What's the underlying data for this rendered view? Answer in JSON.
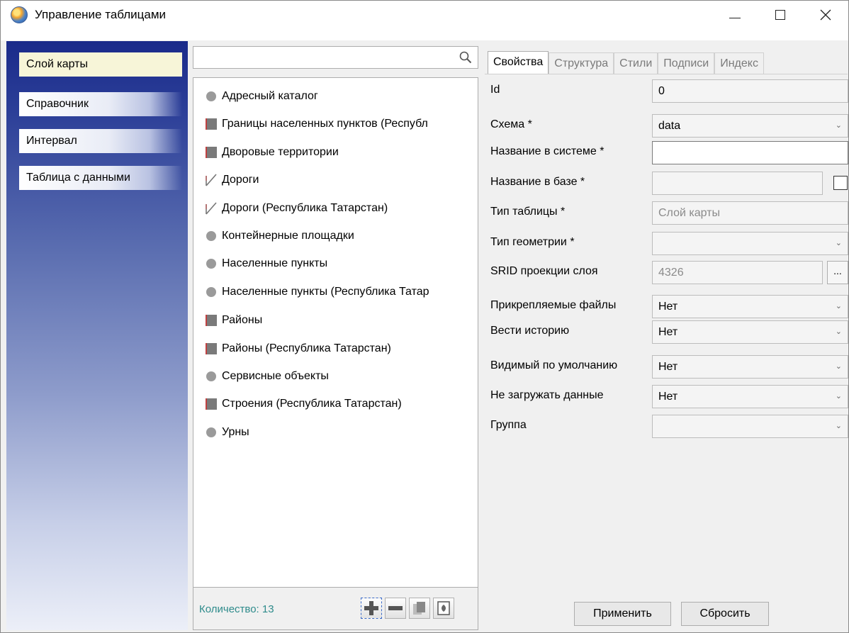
{
  "window": {
    "title": "Управление таблицами"
  },
  "nav": {
    "items": [
      {
        "label": "Слой карты",
        "active": true
      },
      {
        "label": "Справочник",
        "active": false
      },
      {
        "label": "Интервал",
        "active": false
      },
      {
        "label": "Таблица с данными",
        "active": false
      }
    ]
  },
  "search": {
    "value": "",
    "placeholder": ""
  },
  "list": {
    "items": [
      {
        "label": "Адресный каталог",
        "icon": "point-icon"
      },
      {
        "label": "Границы населенных пунктов (Республ",
        "icon": "polygon-icon"
      },
      {
        "label": "Дворовые территории",
        "icon": "polygon-icon"
      },
      {
        "label": "Дороги",
        "icon": "line-icon"
      },
      {
        "label": "Дороги (Республика Татарстан)",
        "icon": "line-icon"
      },
      {
        "label": "Контейнерные площадки",
        "icon": "point-icon"
      },
      {
        "label": "Населенные пункты",
        "icon": "point-icon"
      },
      {
        "label": "Населенные пункты (Республика Татар",
        "icon": "point-icon"
      },
      {
        "label": "Районы",
        "icon": "polygon-icon"
      },
      {
        "label": "Районы (Республика Татарстан)",
        "icon": "polygon-icon"
      },
      {
        "label": "Сервисные объекты",
        "icon": "point-icon"
      },
      {
        "label": "Строения (Республика Татарстан)",
        "icon": "polygon-icon"
      },
      {
        "label": "Урны",
        "icon": "point-icon"
      }
    ],
    "count_label": "Количество: 13"
  },
  "tabs": [
    {
      "label": "Свойства",
      "active": true
    },
    {
      "label": "Структура",
      "active": false
    },
    {
      "label": "Стили",
      "active": false
    },
    {
      "label": "Подписи",
      "active": false
    },
    {
      "label": "Индекс",
      "active": false
    }
  ],
  "form": {
    "id": {
      "label": "Id",
      "value": "0"
    },
    "schema": {
      "label": "Схема *",
      "value": "data"
    },
    "system_name": {
      "label": "Название в системе *",
      "value": ""
    },
    "db_name": {
      "label": "Название в базе *",
      "value": ""
    },
    "table_type": {
      "label": "Тип таблицы *",
      "value": "Слой карты"
    },
    "geometry_type": {
      "label": "Тип геометрии *",
      "value": ""
    },
    "srid": {
      "label": "SRID проекции слоя",
      "value": "4326",
      "button": "..."
    },
    "attach_files": {
      "label": "Прикрепляемые файлы",
      "value": "Нет"
    },
    "history": {
      "label": "Вести историю",
      "value": "Нет"
    },
    "visible_default": {
      "label": "Видимый по умолчанию",
      "value": "Нет"
    },
    "no_load": {
      "label": "Не загружать данные",
      "value": "Нет"
    },
    "group": {
      "label": "Группа",
      "value": ""
    }
  },
  "buttons": {
    "apply": "Применить",
    "reset": "Сбросить"
  },
  "colors": {
    "nav_active_bg": "#f7f5d8",
    "count_text": "#2e8b8b",
    "nav_gradient_top": "#1a2a8a"
  }
}
